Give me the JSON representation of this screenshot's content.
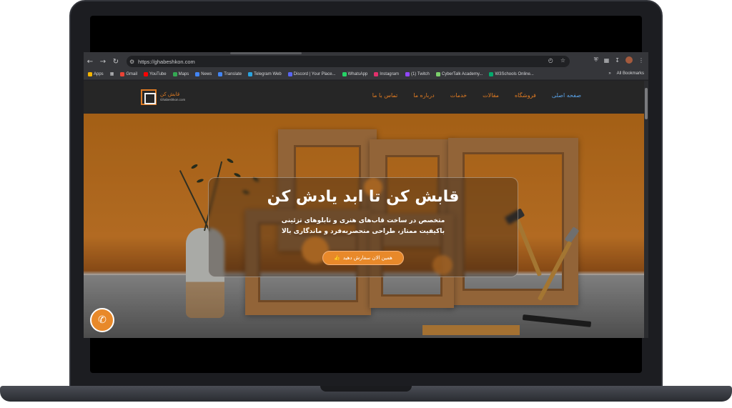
{
  "browser": {
    "url": "https://ghabeshkon.com",
    "bookmarks": [
      {
        "label": "Apps",
        "color": "#f4b400"
      },
      {
        "label": "Gmail",
        "color": "#ea4335"
      },
      {
        "label": "YouTube",
        "color": "#ff0000"
      },
      {
        "label": "Maps",
        "color": "#34a853"
      },
      {
        "label": "News",
        "color": "#4285f4"
      },
      {
        "label": "Translate",
        "color": "#4285f4"
      },
      {
        "label": "Telegram Web",
        "color": "#2aa3e0"
      },
      {
        "label": "Discord | Your Place...",
        "color": "#5865f2"
      },
      {
        "label": "WhatsApp",
        "color": "#25d366"
      },
      {
        "label": "Instagram",
        "color": "#e1306c"
      },
      {
        "label": "(1) Twitch",
        "color": "#9146ff"
      },
      {
        "label": "CyberTalk Academy...",
        "color": "#7bd06b"
      },
      {
        "label": "W3Schools Online...",
        "color": "#04aa6d"
      }
    ],
    "all_bookmarks": "All Bookmarks"
  },
  "site": {
    "logo_name": "قابش کن",
    "logo_sub": "Ghabeshkon.com",
    "menu": [
      {
        "label": "صفحه اصلی",
        "active": true
      },
      {
        "label": "فروشگاه",
        "active": false
      },
      {
        "label": "مقالات",
        "active": false
      },
      {
        "label": "خدمات",
        "active": false
      },
      {
        "label": "درباره ما",
        "active": false
      },
      {
        "label": "تماس با ما",
        "active": false
      }
    ],
    "hero_title": "قابش کن تا ابد یادش کن",
    "hero_line1": "متخصص در ساخت قاب‌های هنری و تابلوهای تزئینی",
    "hero_line2": "باکیفیت ممتاز، طراحی منحصربه‌فرد و ماندگاری بالا",
    "cta_label": "همین الان سفارش دهید"
  },
  "colors": {
    "accent": "#e8892a",
    "menu_active": "#5aa2e6",
    "header_bg": "#262626"
  }
}
